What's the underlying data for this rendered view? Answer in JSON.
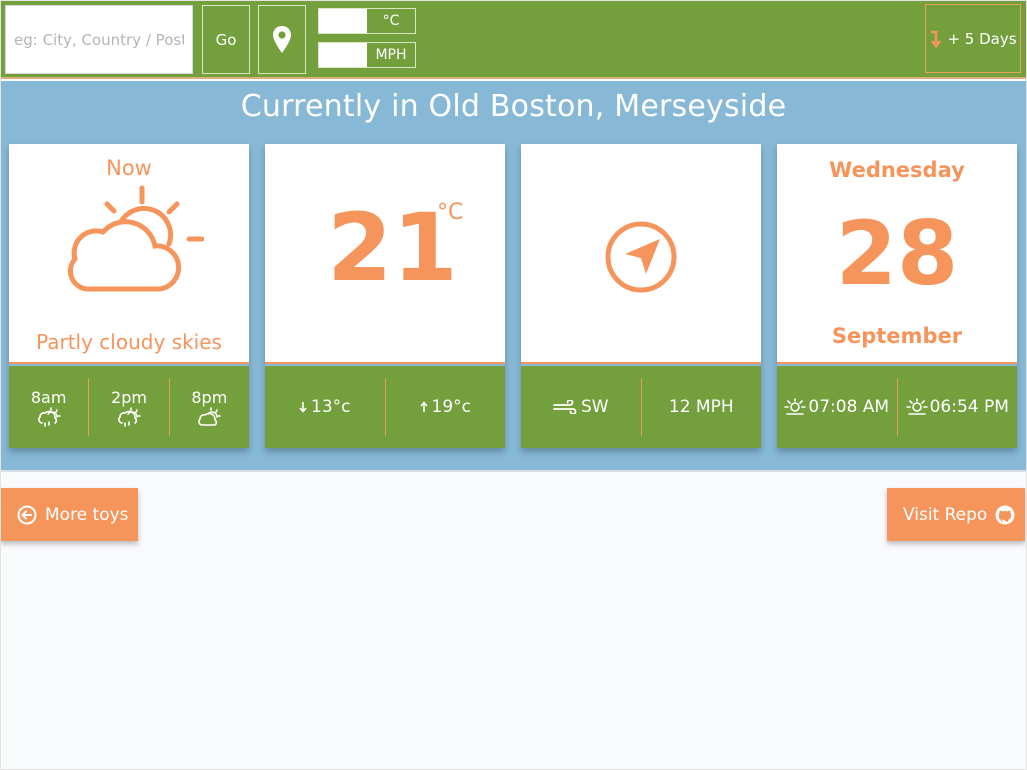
{
  "search": {
    "placeholder": "eg: City, Country / Post Code",
    "value": ""
  },
  "toolbar": {
    "go_label": "Go",
    "temp_unit_label": "°C",
    "speed_unit_label": "MPH",
    "days_label": "+ 5 Days"
  },
  "location": {
    "title": "Currently in Old Boston, Merseyside"
  },
  "cards": {
    "now": {
      "label": "Now",
      "condition": "Partly cloudy skies",
      "forecast": [
        {
          "time": "8am",
          "icon": "rain-cloud-sun-icon"
        },
        {
          "time": "2pm",
          "icon": "rain-cloud-sun-icon"
        },
        {
          "time": "8pm",
          "icon": "cloud-sun-icon"
        }
      ]
    },
    "temperature": {
      "value": "21",
      "unit": "°C",
      "low": "13°c",
      "high": "19°c"
    },
    "wind": {
      "direction": "SW",
      "speed": "12 MPH"
    },
    "date": {
      "weekday": "Wednesday",
      "day": "28",
      "month": "September",
      "sunrise": "07:08 AM",
      "sunset": "06:54 PM"
    }
  },
  "buttons": {
    "more_toys": "More toys",
    "visit_repo": "Visit Repo"
  },
  "colors": {
    "green": "#739f3d",
    "orange": "#f6955b",
    "sky": "#87b9d7"
  }
}
